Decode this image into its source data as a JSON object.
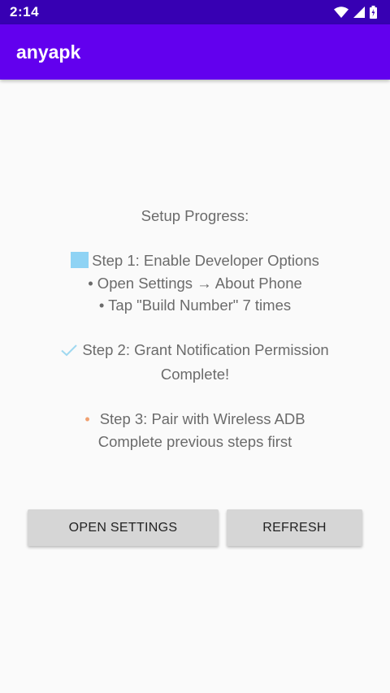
{
  "status_bar": {
    "time": "2:14",
    "icons": [
      "wifi-icon",
      "signal-icon",
      "battery-icon"
    ]
  },
  "app_bar": {
    "title": "anyapk",
    "color": "#6200ee"
  },
  "setup": {
    "heading": "Setup Progress:",
    "step1": {
      "icon": "square-icon",
      "title": "Step 1: Enable Developer Options",
      "detail1": "• Open Settings → About Phone",
      "detail2": "• Tap \"Build Number\" 7 times"
    },
    "step2": {
      "icon": "check-icon",
      "title": "Step 2: Grant Notification Permission",
      "status": "Complete!"
    },
    "step3": {
      "icon": "dot-icon",
      "bullet": "•",
      "title": "Step 3: Pair with Wireless ADB",
      "status": "Complete previous steps first"
    }
  },
  "buttons": {
    "open_settings": "OPEN SETTINGS",
    "refresh": "REFRESH"
  }
}
